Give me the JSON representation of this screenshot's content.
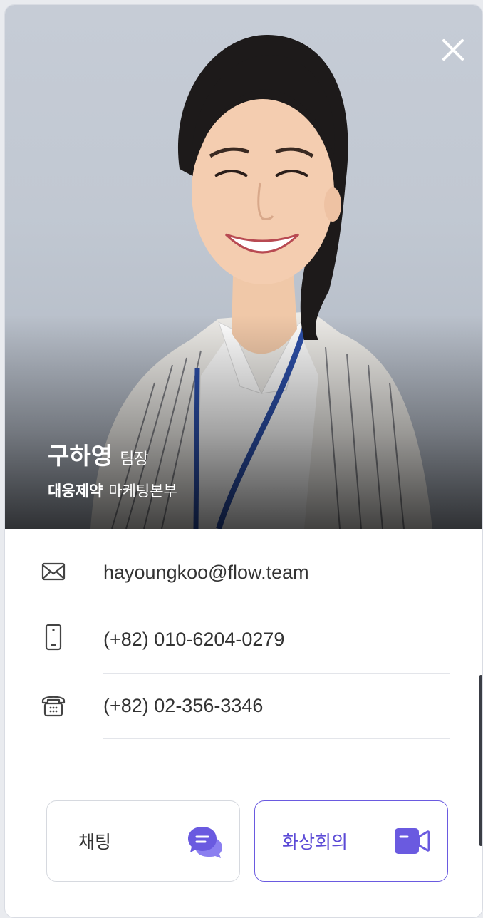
{
  "profile": {
    "name": "구하영",
    "rank": "팀장",
    "company": "대웅제약",
    "department": "마케팅본부"
  },
  "contacts": {
    "email": "hayoungkoo@flow.team",
    "mobile": "(+82) 010-6204-0279",
    "phone": "(+82) 02-356-3346"
  },
  "actions": {
    "chat_label": "채팅",
    "video_label": "화상회의"
  },
  "icons": {
    "close": "close-icon",
    "email": "envelope-icon",
    "mobile": "mobile-phone-icon",
    "phone": "telephone-icon",
    "chat": "chat-bubbles-icon",
    "video": "video-camera-icon"
  },
  "colors": {
    "accent": "#6a5ae0",
    "accent_text": "#5b4ad6",
    "text": "#333333",
    "divider": "#e3e5ea"
  }
}
